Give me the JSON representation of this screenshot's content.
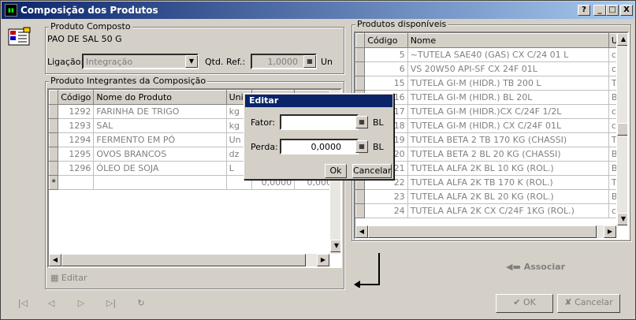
{
  "window": {
    "title": "Composição dos Produtos",
    "controls": [
      "?",
      "_",
      "□",
      "X"
    ]
  },
  "produto_composto": {
    "group_label": "Produto Composto",
    "value": "PAO DE SAL 50 G",
    "ligacao_label": "Ligação:",
    "ligacao_value": "Integração",
    "qtd_label": "Qtd. Ref.:",
    "qtd_value": "1,0000",
    "qtd_unit": "Un"
  },
  "integrantes": {
    "group_label": "Produto Integrantes da Composição",
    "columns": [
      "Código",
      "Nome do Produto",
      "Unid"
    ],
    "rows": [
      {
        "codigo": "1292",
        "nome": "FARINHA DE TRIGO",
        "unid": "kg"
      },
      {
        "codigo": "1293",
        "nome": "SAL",
        "unid": "kg"
      },
      {
        "codigo": "1294",
        "nome": "FERMENTO EM PÓ",
        "unid": "Un"
      },
      {
        "codigo": "1295",
        "nome": "OVOS BRANCOS",
        "unid": "dz"
      },
      {
        "codigo": "1296",
        "nome": "ÓLEO DE SOJA",
        "unid": "L"
      }
    ],
    "new_row_marker": "*",
    "new_row_values": [
      "0,0000",
      "0,0000"
    ],
    "editar_label": "Editar"
  },
  "disponiveis": {
    "group_label": "Produtos disponíveis",
    "columns": [
      "Código",
      "Nome",
      "U"
    ],
    "rows": [
      {
        "codigo": "5",
        "nome": "~TUTELA SAE40 (GAS) CX C/24 01 L",
        "u": "c"
      },
      {
        "codigo": "6",
        "nome": "VS 20W50 API-SF CX 24F 01L",
        "u": "c"
      },
      {
        "codigo": "15",
        "nome": "TUTELA GI-M (HIDR.) TB 200 L",
        "u": "T"
      },
      {
        "codigo": "16",
        "nome": "TUTELA GI-M (HIDR.) BL 20L",
        "u": "B"
      },
      {
        "codigo": "17",
        "nome": "TUTELA GI-M (HIDR.)CX C/24F 1/2L",
        "u": "c"
      },
      {
        "codigo": "18",
        "nome": "TUTELA GI-M (HIDR.) CX C/24F 01L",
        "u": "c"
      },
      {
        "codigo": "19",
        "nome": "TUTELA BETA 2 TB 170 KG (CHASSI)",
        "u": "T"
      },
      {
        "codigo": "20",
        "nome": "TUTELA BETA 2 BL 20 KG (CHASSI)",
        "u": "B"
      },
      {
        "codigo": "21",
        "nome": "TUTELA ALFA 2K BL 10 KG (ROL.)",
        "u": "B"
      },
      {
        "codigo": "22",
        "nome": "TUTELA ALFA 2K TB 170 K (ROL.)",
        "u": "T"
      },
      {
        "codigo": "23",
        "nome": "TUTELA ALFA 2K BL 20 KG (ROL.)",
        "u": "B"
      },
      {
        "codigo": "24",
        "nome": "TUTELA ALFA 2K CX C/24F 1KG (ROL.)",
        "u": "c"
      }
    ],
    "associar_label": "Associar"
  },
  "dialog": {
    "title": "Editar",
    "fator_label": "Fator:",
    "fator_value": "",
    "fator_unit": "BL",
    "perda_label": "Perda:",
    "perda_value": "0,0000",
    "perda_unit": "BL",
    "ok_label": "Ok",
    "cancel_label": "Cancelar"
  },
  "footer": {
    "ok_label": "OK",
    "cancel_label": "Cancelar",
    "nav_first": "|◁",
    "nav_prev": "◁",
    "nav_next": "▷",
    "nav_last": "▷|",
    "nav_refresh": "↻"
  },
  "colors": {
    "title_start": "#0a246a",
    "title_end": "#a6caf0",
    "face": "#d4d0c8"
  }
}
